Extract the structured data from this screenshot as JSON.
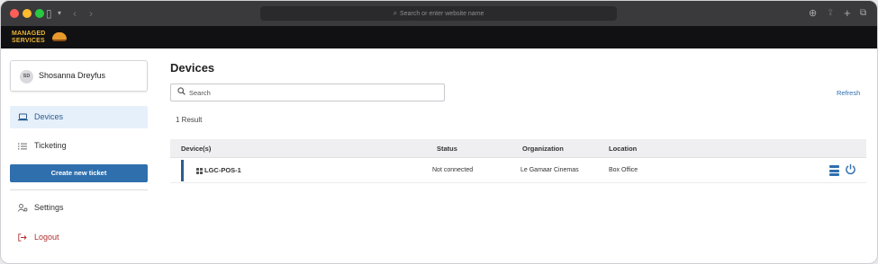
{
  "browser": {
    "address_placeholder": "Search or enter website name",
    "icons": [
      "sidebar-icon",
      "chevron-down-icon",
      "back-icon",
      "forward-icon",
      "download-icon",
      "share-icon",
      "new-tab-icon",
      "tabs-icon"
    ]
  },
  "app": {
    "logo_line1": "MANAGED",
    "logo_line2": "SERVICES",
    "brand_color": "#f0b93a"
  },
  "user": {
    "initials": "SD",
    "name": "Shosanna Dreyfus"
  },
  "sidebar": {
    "items": [
      {
        "label": "Devices",
        "icon": "laptop-icon",
        "active": true
      },
      {
        "label": "Ticketing",
        "icon": "list-icon",
        "active": false
      }
    ],
    "create_ticket_label": "Create new ticket",
    "settings_label": "Settings",
    "logout_label": "Logout"
  },
  "main": {
    "title": "Devices",
    "search_placeholder": "Search",
    "refresh_label": "Refresh",
    "result_count": "1 Result",
    "accent_color": "#2f6fae"
  },
  "table": {
    "columns": [
      "Device(s)",
      "Status",
      "Organization",
      "Location"
    ],
    "rows": [
      {
        "device": "LGC-POS-1",
        "status": "Not connected",
        "organization": "Le Gamaar Cinemas",
        "location": "Box Office"
      }
    ]
  }
}
